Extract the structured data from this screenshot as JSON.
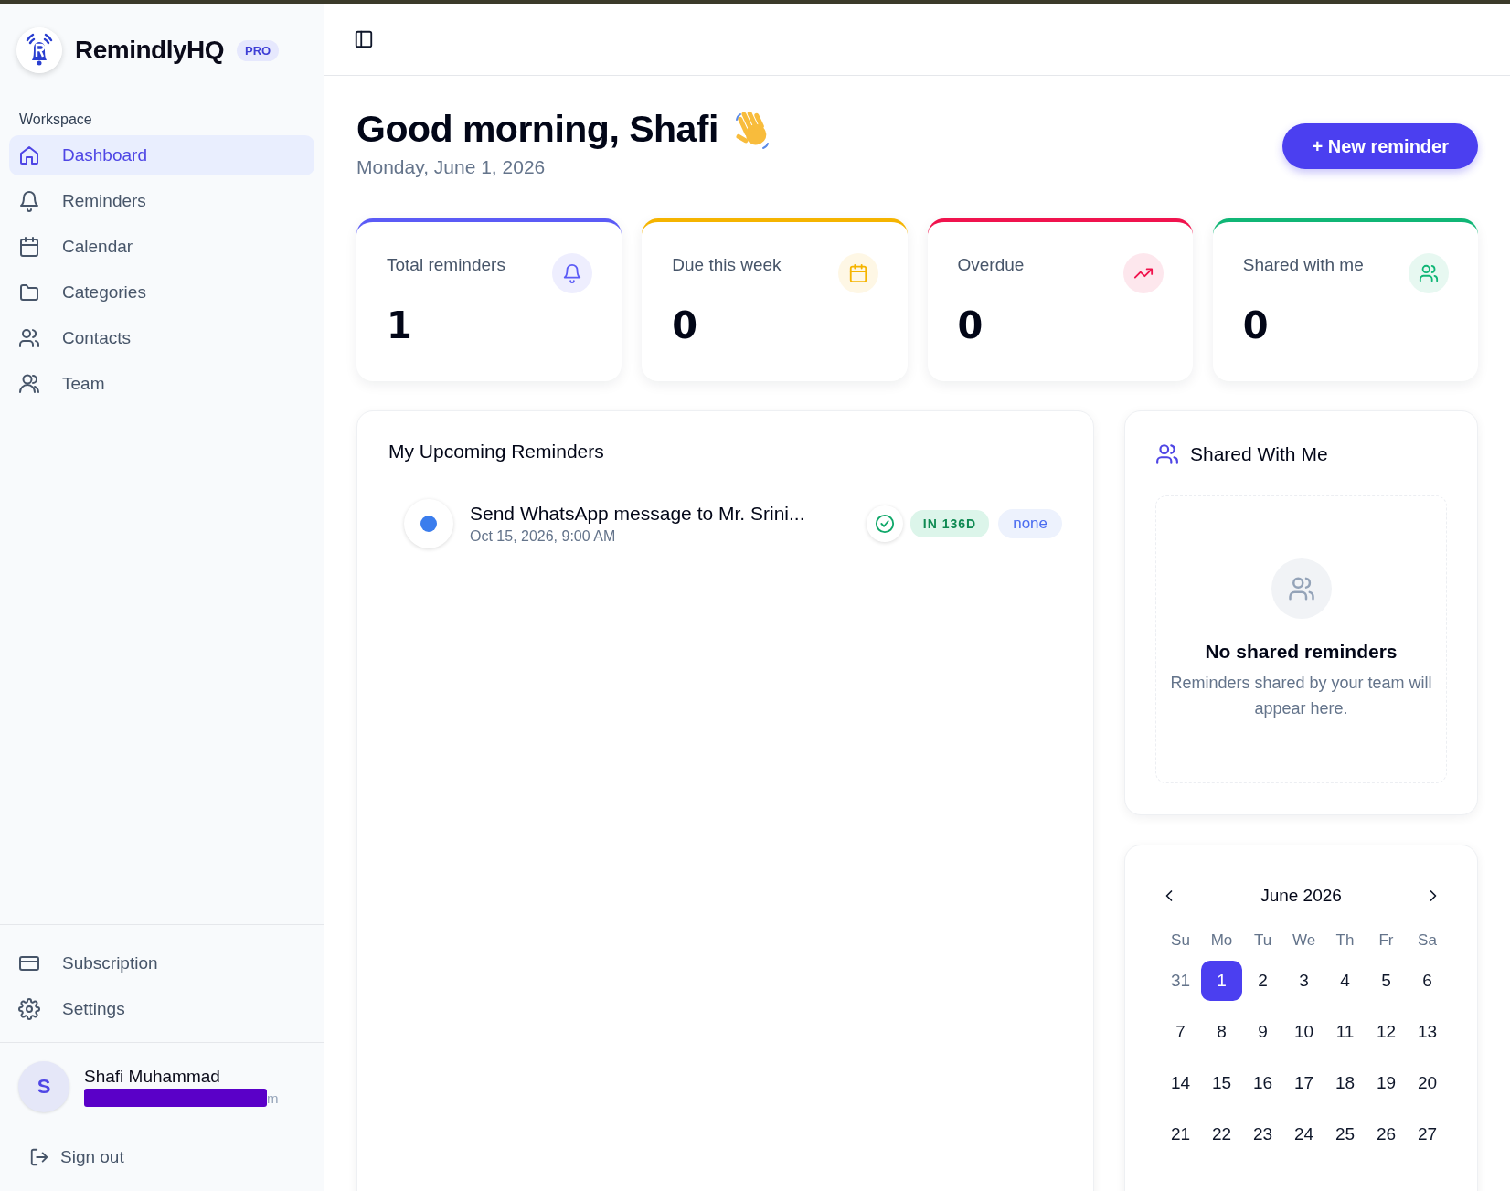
{
  "brand": {
    "name": "RemindlyHQ",
    "badge": "PRO"
  },
  "sidebar": {
    "section": "Workspace",
    "items": [
      {
        "label": "Dashboard",
        "selected": true
      },
      {
        "label": "Reminders",
        "selected": false
      },
      {
        "label": "Calendar",
        "selected": false
      },
      {
        "label": "Categories",
        "selected": false
      },
      {
        "label": "Contacts",
        "selected": false
      },
      {
        "label": "Team",
        "selected": false
      }
    ],
    "bottom_items": [
      {
        "label": "Subscription",
        "selected": false
      },
      {
        "label": "Settings",
        "selected": false
      }
    ],
    "user": {
      "initial": "S",
      "name": "Shafi Muhammad",
      "email_visible": "m"
    },
    "sign_out": "Sign out"
  },
  "header": {
    "greeting": "Good morning, Shafi",
    "date": "Monday, June 1, 2026",
    "button": "+ New reminder"
  },
  "stats": [
    {
      "label": "Total reminders",
      "value": "1",
      "color": "#5b5bf6"
    },
    {
      "label": "Due this week",
      "value": "0",
      "color": "#f5b400"
    },
    {
      "label": "Overdue",
      "value": "0",
      "color": "#f0134d"
    },
    {
      "label": "Shared with me",
      "value": "0",
      "color": "#10b676"
    }
  ],
  "upcoming": {
    "title": "My Upcoming Reminders",
    "items": [
      {
        "title": "Send WhatsApp message to Mr. Srini...",
        "time": "Oct 15, 2026, 9:00 AM",
        "due": "IN 136D",
        "tag": "none"
      }
    ]
  },
  "shared": {
    "title": "Shared With Me",
    "empty_title": "No shared reminders",
    "empty_text": "Reminders shared by your team will appear here."
  },
  "calendar": {
    "month": "June 2026",
    "weekdays": [
      "Su",
      "Mo",
      "Tu",
      "We",
      "Th",
      "Fr",
      "Sa"
    ],
    "days": [
      {
        "label": "31",
        "outside": true,
        "selected": false
      },
      {
        "label": "1",
        "outside": false,
        "selected": true
      },
      {
        "label": "2",
        "outside": false,
        "selected": false
      },
      {
        "label": "3",
        "outside": false,
        "selected": false
      },
      {
        "label": "4",
        "outside": false,
        "selected": false
      },
      {
        "label": "5",
        "outside": false,
        "selected": false
      },
      {
        "label": "6",
        "outside": false,
        "selected": false
      },
      {
        "label": "7",
        "outside": false,
        "selected": false
      },
      {
        "label": "8",
        "outside": false,
        "selected": false
      },
      {
        "label": "9",
        "outside": false,
        "selected": false
      },
      {
        "label": "10",
        "outside": false,
        "selected": false
      },
      {
        "label": "11",
        "outside": false,
        "selected": false
      },
      {
        "label": "12",
        "outside": false,
        "selected": false
      },
      {
        "label": "13",
        "outside": false,
        "selected": false
      },
      {
        "label": "14",
        "outside": false,
        "selected": false
      },
      {
        "label": "15",
        "outside": false,
        "selected": false
      },
      {
        "label": "16",
        "outside": false,
        "selected": false
      },
      {
        "label": "17",
        "outside": false,
        "selected": false
      },
      {
        "label": "18",
        "outside": false,
        "selected": false
      },
      {
        "label": "19",
        "outside": false,
        "selected": false
      },
      {
        "label": "20",
        "outside": false,
        "selected": false
      },
      {
        "label": "21",
        "outside": false,
        "selected": false
      },
      {
        "label": "22",
        "outside": false,
        "selected": false
      },
      {
        "label": "23",
        "outside": false,
        "selected": false
      },
      {
        "label": "24",
        "outside": false,
        "selected": false
      },
      {
        "label": "25",
        "outside": false,
        "selected": false
      },
      {
        "label": "26",
        "outside": false,
        "selected": false
      },
      {
        "label": "27",
        "outside": false,
        "selected": false
      }
    ]
  }
}
